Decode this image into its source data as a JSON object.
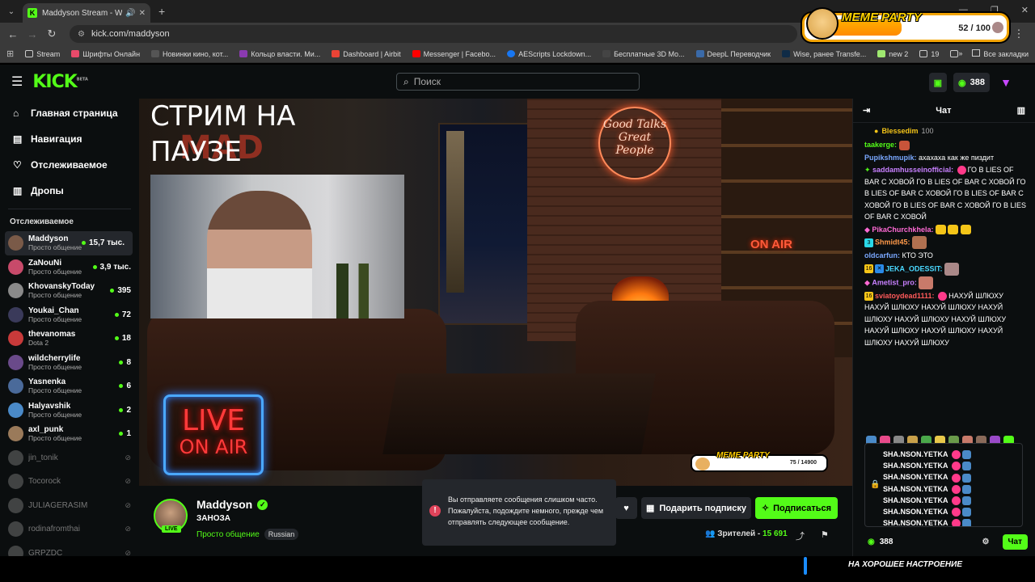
{
  "browser": {
    "tab_title": "Maddyson Stream - Watch",
    "url": "kick.com/maddyson",
    "bookmarks": [
      "Stream",
      "Шрифты Онлайн",
      "Новинки кино, кот...",
      "Кольцо власти. Ми...",
      "Dashboard | Airbit",
      "Messenger | Facebo...",
      "AEScripts Lockdown...",
      "Бесплатные 3D Mo...",
      "DeepL Переводчик",
      "Wise, ранее Transfe...",
      "new 2",
      "19"
    ],
    "all_bookmarks": "Все закладки"
  },
  "meme_overlay": {
    "title": "MEME PARTY",
    "count": "52 / 100"
  },
  "header": {
    "search_placeholder": "Поиск",
    "points": "388"
  },
  "sidebar": {
    "nav": [
      {
        "label": "Главная страница",
        "icon": "home-icon"
      },
      {
        "label": "Навигация",
        "icon": "compass-icon"
      },
      {
        "label": "Отслеживаемое",
        "icon": "heart-icon"
      },
      {
        "label": "Дропы",
        "icon": "gift-icon"
      }
    ],
    "section_title": "Отслеживаемое",
    "channels": [
      {
        "name": "Maddyson",
        "cat": "Просто общение",
        "viewers": "15,7 тыс.",
        "live": true,
        "color": "#7a5a48"
      },
      {
        "name": "ZaNouNi",
        "cat": "Просто общение",
        "viewers": "3,9 тыс.",
        "live": true,
        "color": "#c84a6a"
      },
      {
        "name": "KhovanskyToday",
        "cat": "Просто общение",
        "viewers": "395",
        "live": true,
        "color": "#8a8a8a"
      },
      {
        "name": "Youkai_Chan",
        "cat": "Просто общение",
        "viewers": "72",
        "live": true,
        "color": "#3a3a5a"
      },
      {
        "name": "thevanomas",
        "cat": "Dota 2",
        "viewers": "18",
        "live": true,
        "color": "#c83a3a"
      },
      {
        "name": "wildcherrylife",
        "cat": "Просто общение",
        "viewers": "8",
        "live": true,
        "color": "#6a4a8a"
      },
      {
        "name": "Yasnenka",
        "cat": "Просто общение",
        "viewers": "6",
        "live": true,
        "color": "#4a6a9a"
      },
      {
        "name": "Halyavshik",
        "cat": "Просто общение",
        "viewers": "2",
        "live": true,
        "color": "#4a8ac8"
      },
      {
        "name": "axl_punk",
        "cat": "Просто общение",
        "viewers": "1",
        "live": true,
        "color": "#9a7a5a"
      },
      {
        "name": "jin_tonik",
        "cat": "",
        "viewers": "",
        "live": false,
        "color": "#777"
      },
      {
        "name": "Tocorock",
        "cat": "",
        "viewers": "",
        "live": false,
        "color": "#777"
      },
      {
        "name": "JULIAGERASIM",
        "cat": "",
        "viewers": "",
        "live": false,
        "color": "#777"
      },
      {
        "name": "rodinafromthai",
        "cat": "",
        "viewers": "",
        "live": false,
        "color": "#777"
      },
      {
        "name": "GRPZDC",
        "cat": "",
        "viewers": "",
        "live": false,
        "color": "#777"
      }
    ]
  },
  "video": {
    "pause_text": "СТРИМ НА ПАУЗЕ",
    "mad_logo": "MAD",
    "live_line1": "LIVE",
    "live_line2": "ON AIR",
    "neon_sign": "Good Talks Great People",
    "on_air": "ON AIR",
    "meme_small_title": "MEME PARTY",
    "meme_small_count": "75 / 14900"
  },
  "stream_info": {
    "name": "Maddyson",
    "live_badge": "LIVE",
    "title": "ЗАНОЗА",
    "category": "Просто общение",
    "language": "Russian",
    "gift_label": "Подарить подписку",
    "follow_label": "Подписаться",
    "viewers_label": "Зрителей -",
    "viewers_count": "15 691"
  },
  "toast": {
    "text": "Вы отправляете сообщения слишком часто. Пожалуйста, подождите немного, прежде чем отправлять следующее сообщение."
  },
  "chat": {
    "title": "Чат",
    "pinned_user": "Blessedim",
    "pinned_amount": "100",
    "messages": [
      {
        "user": "taakerge:",
        "color": "#53fc18",
        "text": ""
      },
      {
        "user": "Pupikshmupik:",
        "color": "#7aa8ff",
        "text": "ахахаха как же пиздит"
      },
      {
        "user": "saddamhusseinofficial:",
        "color": "#c880ff",
        "text": "ГО В LIES OF BAR С ХОВОЙ ГО В LIES OF BAR С ХОВОЙ ГО В LIES OF BAR С ХОВОЙ ГО В LIES OF BAR С ХОВОЙ ГО В LIES OF BAR С ХОВОЙ ГО В LIES OF BAR С ХОВОЙ"
      },
      {
        "user": "PikaChurchkhela:",
        "color": "#ff6ad5",
        "text": ""
      },
      {
        "user": "Shmidt45:",
        "color": "#ff9a4a",
        "text": ""
      },
      {
        "user": "oldcarfun:",
        "color": "#7aa8ff",
        "text": "КТО ЭТО"
      },
      {
        "user": "JEKA_ODESSIT:",
        "color": "#4ad8ff",
        "text": ""
      },
      {
        "user": "Ametist_pro:",
        "color": "#c880ff",
        "text": ""
      },
      {
        "user": "sviatoydead1111:",
        "color": "#ff5a5a",
        "text": "НАХУЙ ШЛЮХУ НАХУЙ ШЛЮХУ НАХУЙ ШЛЮХУ НАХУЙ ШЛЮХУ НАХУЙ ШЛЮХУ НАХУЙ ШЛЮХУ НАХУЙ ШЛЮХУ НАХУЙ ШЛЮХУ НАХУЙ ШЛЮХУ НАХУЙ ШЛЮХУ"
      }
    ],
    "input_line": "SHA.NSON.YETKA",
    "points": "388",
    "send_label": "Чат"
  },
  "bottom": {
    "text": "НА ХОРОШЕЕ НАСТРОЕНИЕ"
  }
}
